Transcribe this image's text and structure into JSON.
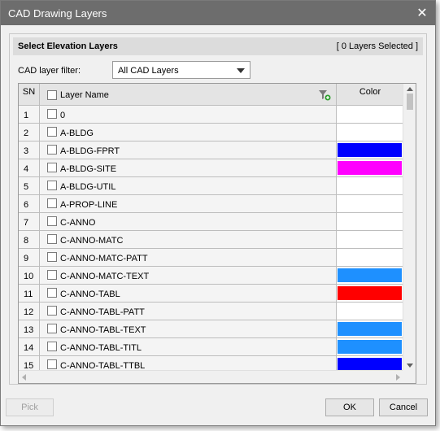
{
  "window": {
    "title": "CAD Drawing Layers"
  },
  "group": {
    "title": "Select Elevation Layers",
    "selected_count": "[ 0 Layers Selected ]"
  },
  "filter": {
    "label": "CAD layer filter:",
    "value": "All CAD Layers"
  },
  "table": {
    "columns": {
      "sn": "SN",
      "name": "Layer Name",
      "color": "Color"
    },
    "rows": [
      {
        "sn": "1",
        "name": "0",
        "color": ""
      },
      {
        "sn": "2",
        "name": "A-BLDG",
        "color": ""
      },
      {
        "sn": "3",
        "name": "A-BLDG-FPRT",
        "color": "#0000ff"
      },
      {
        "sn": "4",
        "name": "A-BLDG-SITE",
        "color": "#ff00ff"
      },
      {
        "sn": "5",
        "name": "A-BLDG-UTIL",
        "color": ""
      },
      {
        "sn": "6",
        "name": "A-PROP-LINE",
        "color": ""
      },
      {
        "sn": "7",
        "name": "C-ANNO",
        "color": ""
      },
      {
        "sn": "8",
        "name": "C-ANNO-MATC",
        "color": ""
      },
      {
        "sn": "9",
        "name": "C-ANNO-MATC-PATT",
        "color": ""
      },
      {
        "sn": "10",
        "name": "C-ANNO-MATC-TEXT",
        "color": "#1e90ff"
      },
      {
        "sn": "11",
        "name": "C-ANNO-TABL",
        "color": "#ff0000"
      },
      {
        "sn": "12",
        "name": "C-ANNO-TABL-PATT",
        "color": ""
      },
      {
        "sn": "13",
        "name": "C-ANNO-TABL-TEXT",
        "color": "#1e90ff"
      },
      {
        "sn": "14",
        "name": "C-ANNO-TABL-TITL",
        "color": "#1e90ff"
      },
      {
        "sn": "15",
        "name": "C-ANNO-TABL-TTBL",
        "color": "#0000ff"
      }
    ]
  },
  "buttons": {
    "pick": "Pick",
    "ok": "OK",
    "cancel": "Cancel"
  },
  "icons": {
    "close": "close-icon",
    "filter": "filter-add-icon",
    "dropdown": "chevron-down-icon"
  }
}
